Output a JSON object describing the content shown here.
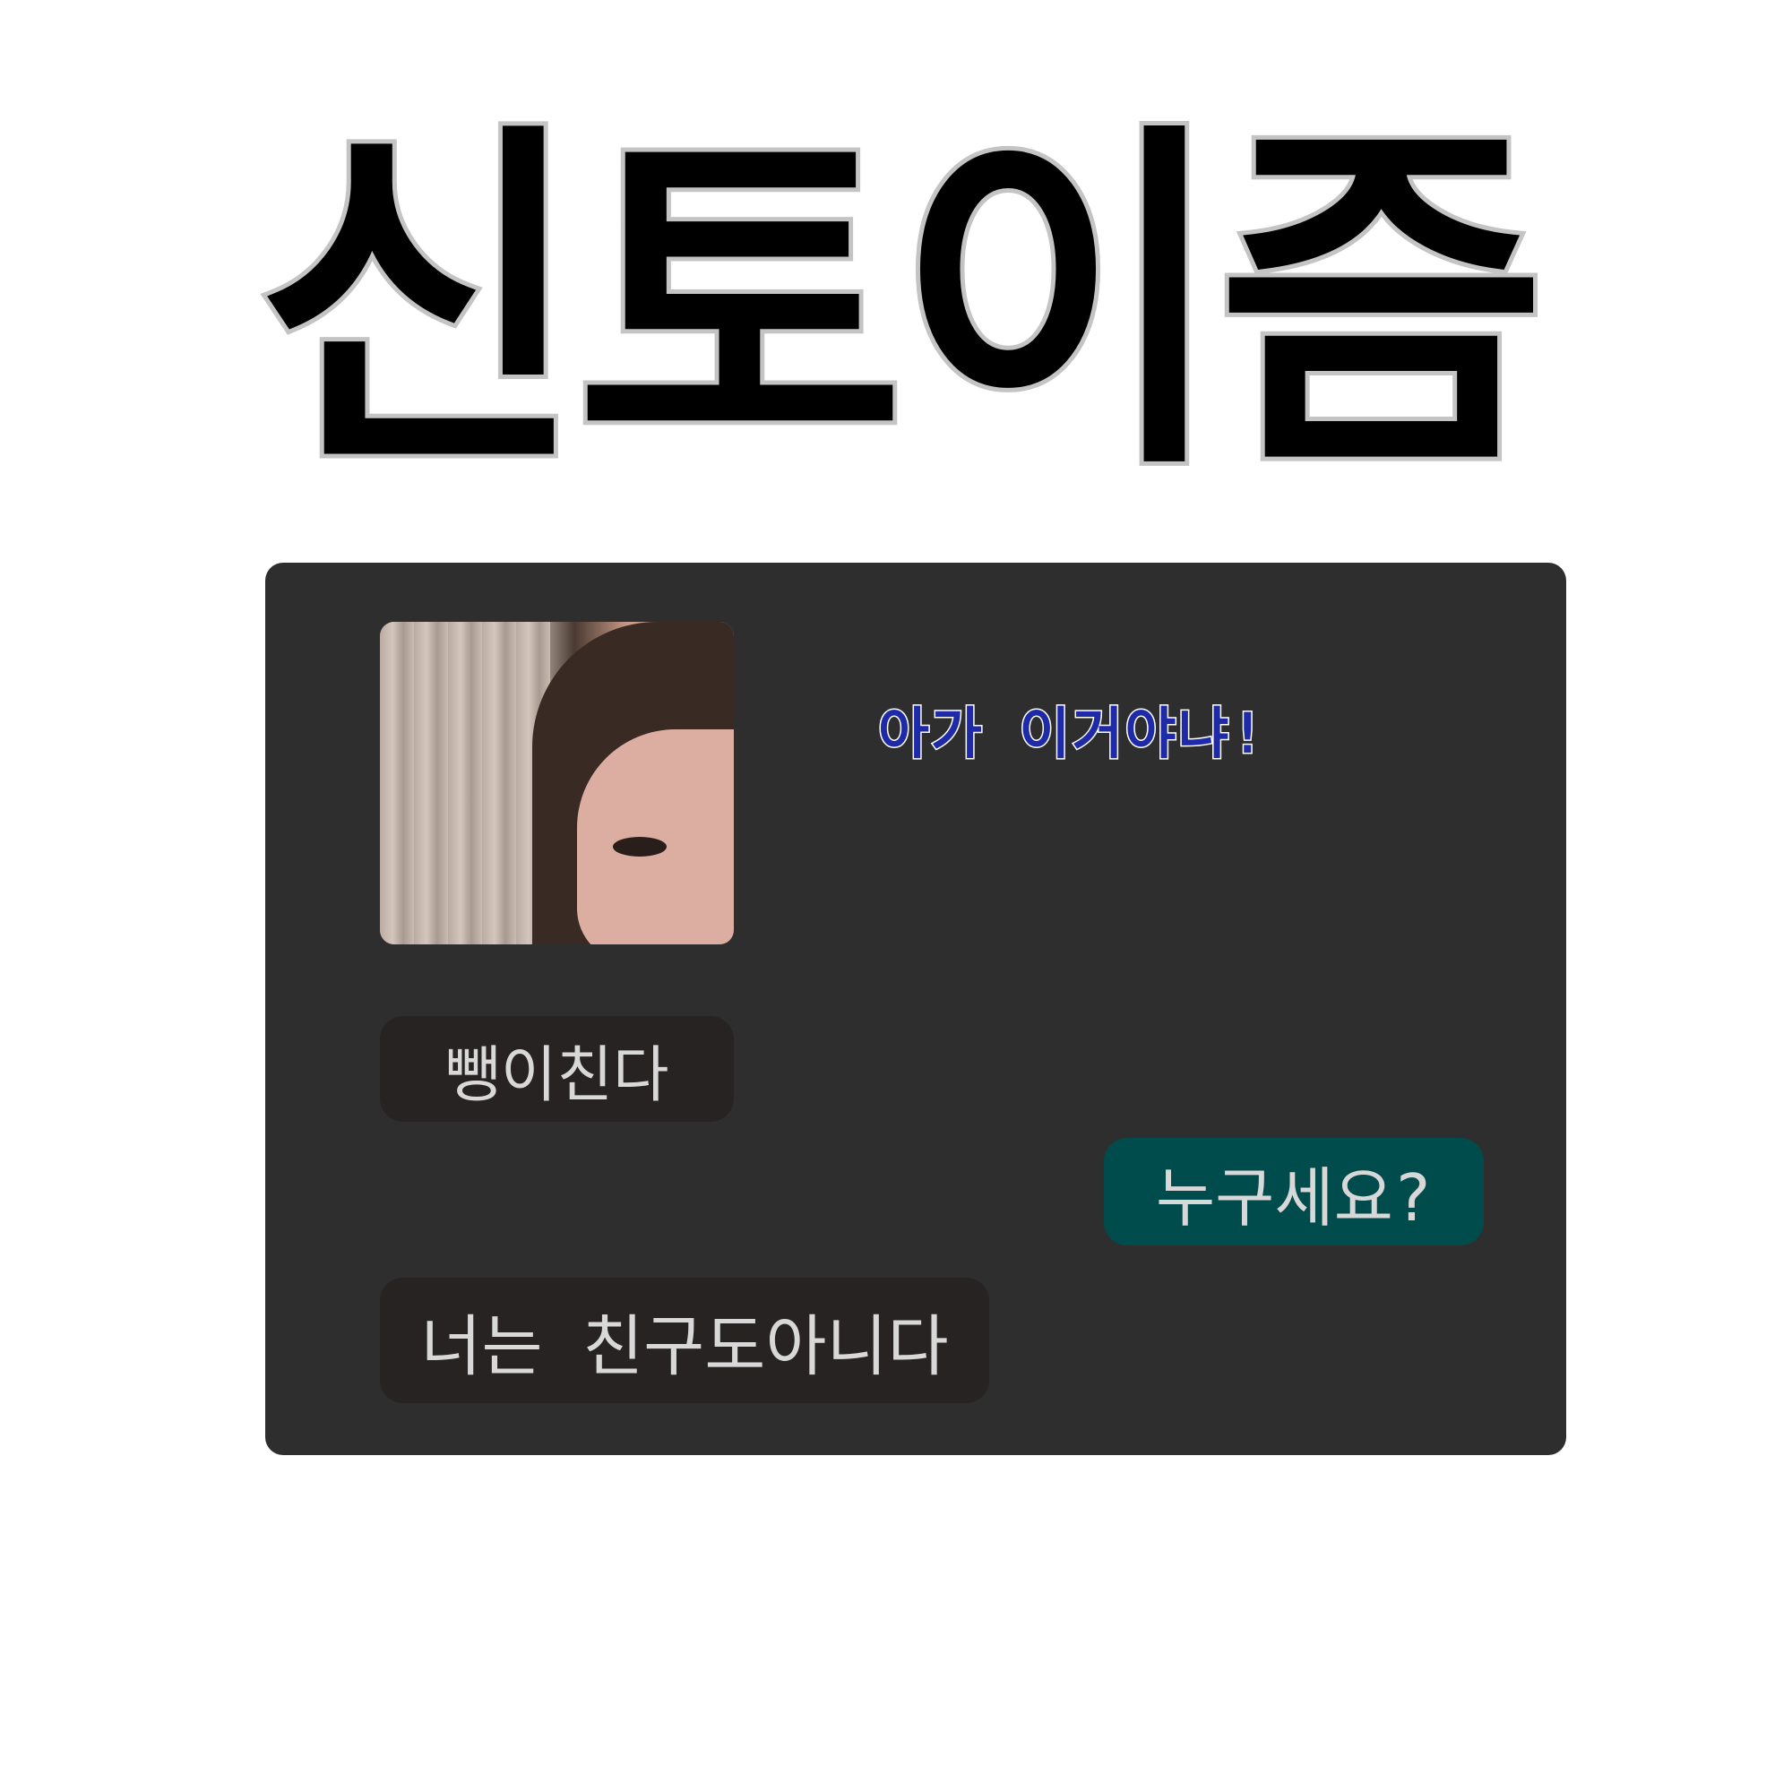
{
  "title": "신토이즘",
  "chat": {
    "status_text": "아가 이거야냐!",
    "messages": [
      {
        "text": "뺑이친다",
        "side": "left"
      },
      {
        "text": "누구세요?",
        "side": "right"
      },
      {
        "text": "너는 친구도아니다",
        "side": "left"
      }
    ]
  },
  "colors": {
    "background": "#ffffff",
    "panel": "#2e2e2e",
    "incoming_bubble": "#272323",
    "outgoing_bubble": "#004c4d",
    "status_text": "#1e2aa8",
    "bubble_text": "#d8d8d8"
  }
}
